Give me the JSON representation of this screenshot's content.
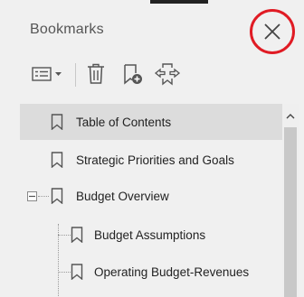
{
  "panel": {
    "title": "Bookmarks",
    "close_icon": "close-icon",
    "close_highlight_color": "#e01b24"
  },
  "toolbar": {
    "options_icon": "options-dropdown-icon",
    "delete_icon": "trash-icon",
    "new_bookmark_icon": "new-bookmark-icon",
    "expand_icon": "expand-current-bookmark-icon"
  },
  "bookmarks": [
    {
      "label": "Table of Contents",
      "level": 0,
      "selected": true
    },
    {
      "label": "Strategic Priorities and Goals",
      "level": 0,
      "selected": false
    },
    {
      "label": "Budget Overview",
      "level": 0,
      "selected": false,
      "expanded": true
    },
    {
      "label": "Budget Assumptions",
      "level": 1,
      "selected": false
    },
    {
      "label": "Operating Budget-Revenues",
      "level": 1,
      "selected": false
    }
  ]
}
